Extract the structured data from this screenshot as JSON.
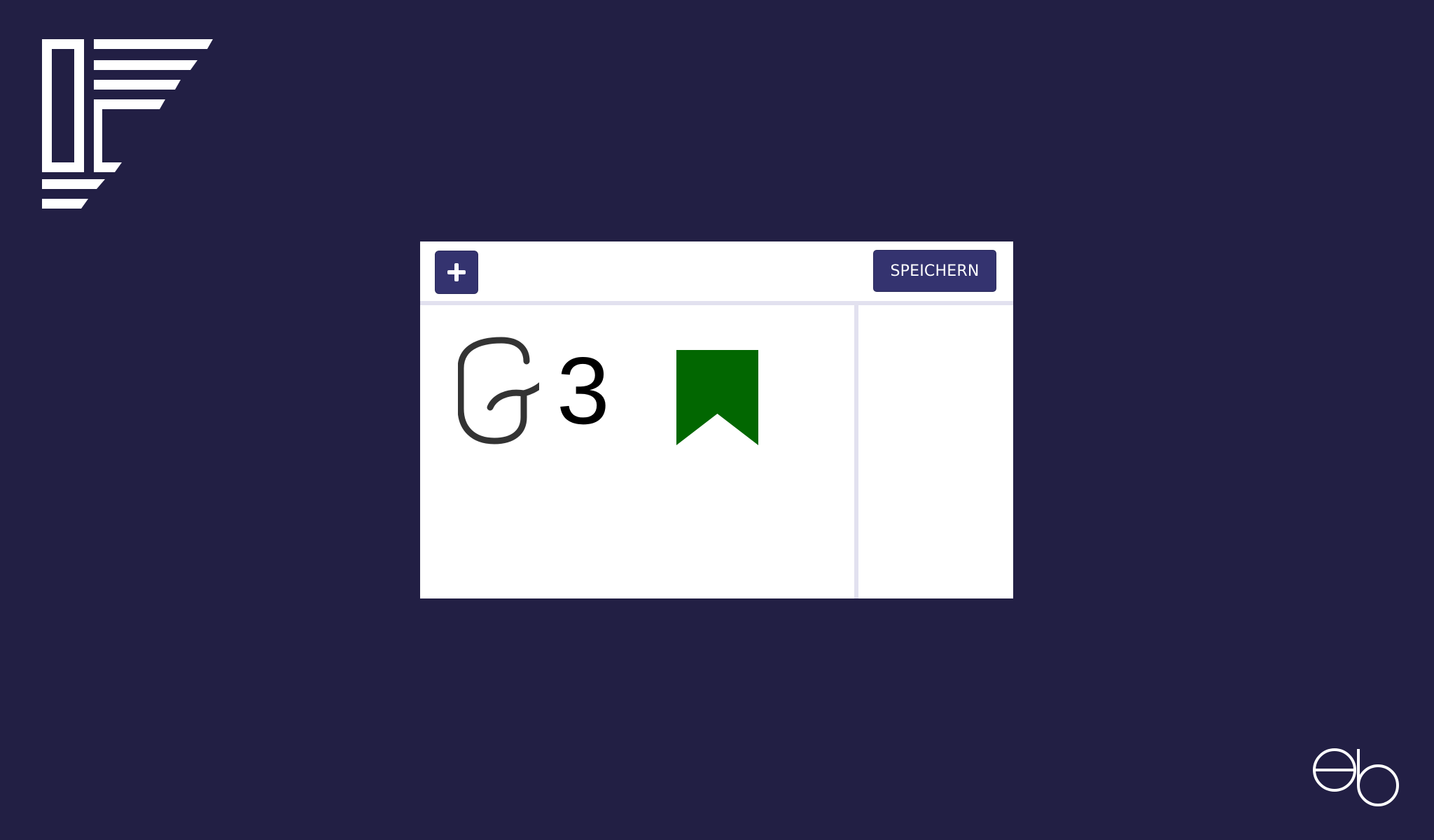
{
  "colors": {
    "background": "#221f44",
    "button": "#34336f",
    "panel_border": "#e2e1ef",
    "flag": "#026701",
    "glyph": "#333333",
    "logo": "#ffffff"
  },
  "toolbar": {
    "add_icon": "plus-icon",
    "save_label": "SPEICHERN"
  },
  "content": {
    "symbol_icon": "script-glyph-icon",
    "grade_label": "3",
    "flag_icon": "bookmark-flag-icon"
  },
  "branding": {
    "logo_icon": "stripes-logo-icon",
    "monogram_icon": "eb-monogram-icon"
  }
}
